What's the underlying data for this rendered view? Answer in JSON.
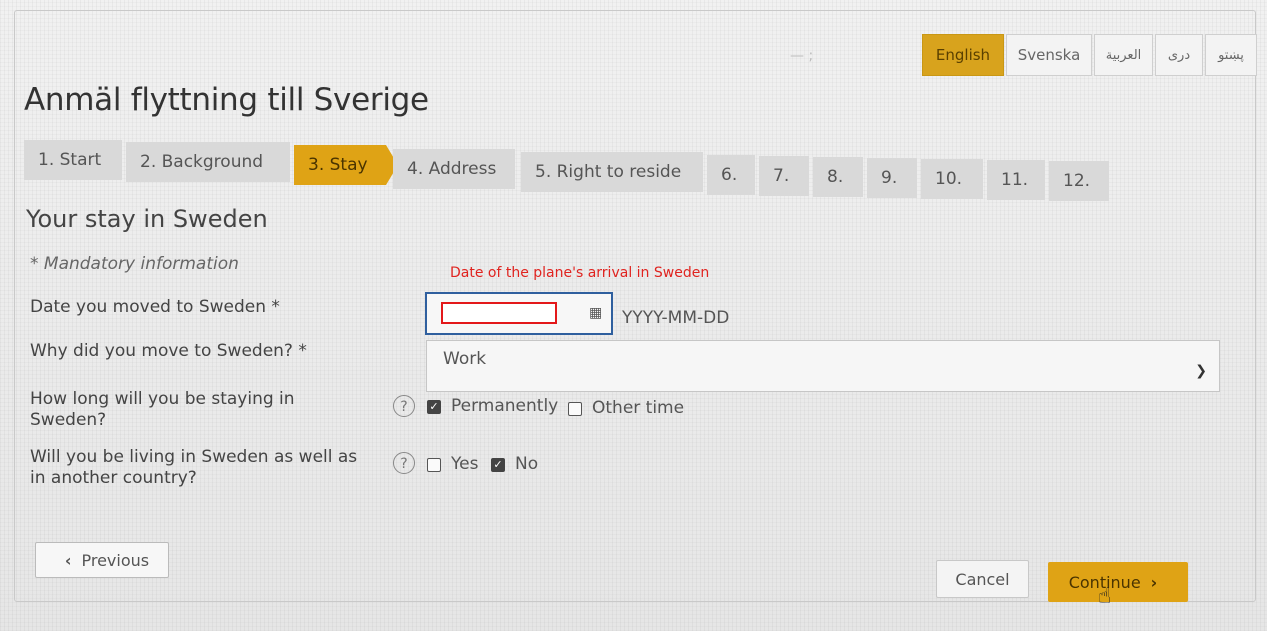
{
  "languages": [
    "English",
    "Svenska",
    "العربية",
    "دری",
    "پښتو"
  ],
  "page_title": "Anmäl flyttning till Sverige",
  "steps": [
    "1. Start",
    "2. Background",
    "3. Stay",
    "4. Address",
    "5. Right to reside",
    "6.",
    "7.",
    "8.",
    "9.",
    "10.",
    "11.",
    "12."
  ],
  "active_step": "3. Stay",
  "section_title": "Your stay in Sweden",
  "mandatory_note": "* Mandatory information",
  "annotation": "Date of the plane's arrival in Sweden",
  "form": {
    "date_label": "Date you moved to Sweden *",
    "date_value": "",
    "date_format": "YYYY-MM-DD",
    "reason_label": "Why did you move to Sweden? *",
    "reason_value": "Work",
    "duration_label": "How long will you be staying in Sweden?",
    "duration_options": [
      "Permanently",
      "Other time"
    ],
    "duration_selected": "Permanently",
    "dual_label": "Will you be living in Sweden as well as in another country?",
    "dual_options": [
      "Yes",
      "No"
    ],
    "dual_selected": "No"
  },
  "buttons": {
    "previous": "Previous",
    "cancel": "Cancel",
    "continue": "Continue"
  },
  "colors": {
    "accent": "#dfa315",
    "focus_border": "#2f5f9e",
    "annotation_red": "#e3181a"
  }
}
